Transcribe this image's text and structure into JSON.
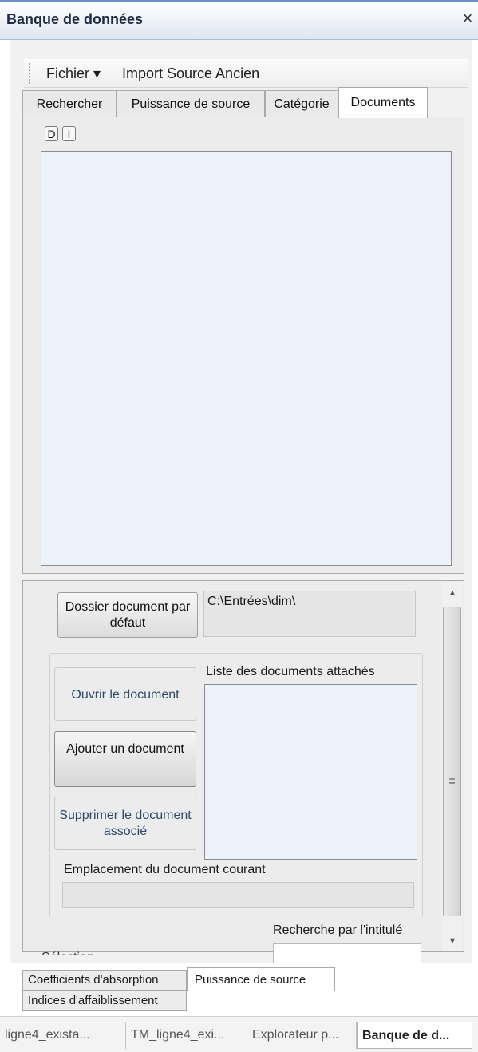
{
  "window": {
    "title": "Banque de données",
    "close": "×"
  },
  "toolbar": {
    "fichier": "Fichier ▾",
    "import": "Import Source Ancien"
  },
  "tabs": {
    "rechercher": "Rechercher",
    "puissance": "Puissance de source",
    "categorie": "Catégorie",
    "documents": "Documents"
  },
  "documents": {
    "btn_d": "D",
    "btn_i": "I",
    "dossier_button": "Dossier document par défaut",
    "path_value": "C:\\Entrées\\dim\\",
    "ouvrir_button": "Ouvrir le document",
    "ajouter_button": "Ajouter un document",
    "supprimer_button": "Supprimer le document associé",
    "liste_label": "Liste des documents attachés",
    "emplacement_label": "Emplacement du document courant",
    "recherche_label": "Recherche par l'intitulé",
    "selection_label": "Sélection"
  },
  "scrollbar": {
    "up": "▲",
    "grip": "≡",
    "down": "▼"
  },
  "bottom_tabs": {
    "coef": "Coefficients d'absorption",
    "puissance": "Puissance de source",
    "indices": "Indices d'affaiblissement"
  },
  "doc_tabs": [
    "ligne4_exista...",
    "TM_ligne4_exi...",
    "Explorateur p...",
    "Banque de d..."
  ]
}
